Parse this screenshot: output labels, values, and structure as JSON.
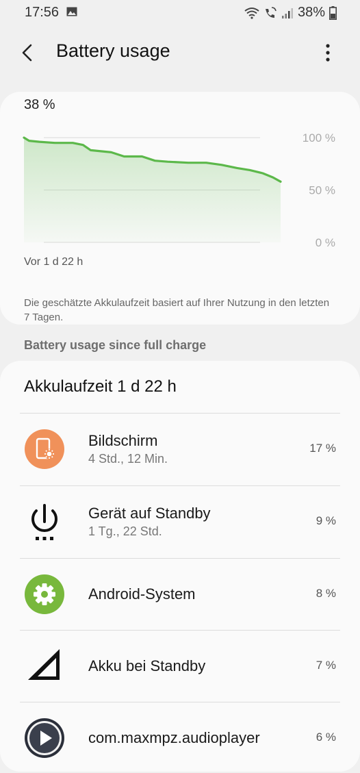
{
  "status_bar": {
    "time": "17:56",
    "battery_percent": "38%"
  },
  "app_bar": {
    "title": "Battery usage"
  },
  "level_card": {
    "current_level": "38 %",
    "y_labels": [
      "100 %",
      "50 %",
      "0 %"
    ],
    "time_label": "Vor 1 d 22 h",
    "note": "Die geschätzte Akkulaufzeit basiert auf Ihrer Nutzung in den letzten 7 Tagen."
  },
  "chart_data": {
    "type": "area",
    "title": "",
    "xlabel": "Vor 1 d 22 h",
    "ylabel": "",
    "ylim": [
      0,
      100
    ],
    "y_ticks": [
      "100 %",
      "50 %",
      "0 %"
    ],
    "grid": true,
    "x": [
      0,
      0.02,
      0.06,
      0.12,
      0.19,
      0.23,
      0.26,
      0.34,
      0.39,
      0.46,
      0.51,
      0.56,
      0.64,
      0.71,
      0.77,
      0.83,
      0.88,
      0.93,
      0.97,
      1.0
    ],
    "series": [
      {
        "values": [
          100,
          97,
          96,
          95,
          95,
          93,
          88,
          86,
          82,
          82,
          78,
          77,
          76,
          76,
          74,
          71,
          69,
          66,
          62,
          58
        ]
      }
    ],
    "color": "#5cb84a"
  },
  "section_header": "Battery usage since full charge",
  "usage_card": {
    "title": "Akkulaufzeit 1 d 22 h",
    "items": [
      {
        "name": "Bildschirm",
        "detail": "4 Std., 12 Min.",
        "percent": "17 %",
        "icon": "screen-brightness-icon"
      },
      {
        "name": "Gerät auf Standby",
        "detail": "1 Tg., 22 Std.",
        "percent": "9 %",
        "icon": "power-standby-icon"
      },
      {
        "name": "Android-System",
        "detail": "",
        "percent": "8 %",
        "icon": "gear-icon"
      },
      {
        "name": "Akku bei Standby",
        "detail": "",
        "percent": "7 %",
        "icon": "signal-icon"
      },
      {
        "name": "com.maxmpz.audioplayer",
        "detail": "",
        "percent": "6 %",
        "icon": "play-icon"
      }
    ]
  },
  "colors": {
    "accent_green": "#5cb84a",
    "screen_icon_orange": "#f0915a",
    "android_green": "#78b83c"
  }
}
